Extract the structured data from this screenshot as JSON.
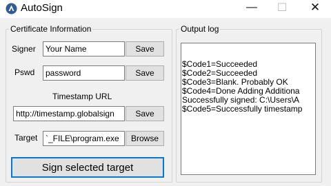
{
  "window": {
    "title": "AutoSign",
    "controls": {
      "minimize": "—",
      "maximize": "☐",
      "close": "✕"
    }
  },
  "certificate": {
    "legend": "Certificate Information",
    "signer_label": "Signer",
    "signer_value": "Your Name",
    "signer_save": "Save",
    "pswd_label": "Pswd",
    "pswd_value": "password",
    "pswd_save": "Save",
    "timestamp_label": "Timestamp URL",
    "timestamp_value": "http://timestamp.globalsign",
    "timestamp_save": "Save",
    "target_label": "Target",
    "target_value": "`_FILE\\program.exe",
    "target_browse": "Browse",
    "sign_button": "Sign selected target"
  },
  "output": {
    "legend": "Output log",
    "lines": [
      "$Code1=Succeeded",
      "$Code2=Succeeded",
      "$Code3=Blank. Probably OK",
      "$Code4=Done Adding Additiona",
      "Successfully signed: C:\\Users\\A",
      "$Code5=Successfully timestamp"
    ]
  },
  "colors": {
    "accent": "#0078d7",
    "icon": "#2f5d93"
  }
}
